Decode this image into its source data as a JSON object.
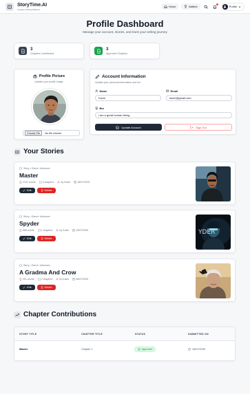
{
  "app": {
    "name": "StoryTime.AI",
    "tagline": "Creative Writing Platform"
  },
  "nav": {
    "home": "Home",
    "battles": "Battles",
    "profile": "Profile"
  },
  "page": {
    "title": "Profile Dashboard",
    "subtitle": "Manage your account, stories, and track your writing journey"
  },
  "stats": [
    {
      "value": "3",
      "label": "Chapters Contributed",
      "color": "#374151",
      "bg": "#374151"
    },
    {
      "value": "3",
      "label": "Approved Chapters",
      "color": "#16a34a",
      "bg": "#16a34a"
    }
  ],
  "profile_picture": {
    "title": "Profile Picture",
    "subtitle": "Update your profile image",
    "choose_file": "Choose File",
    "no_file": "No file chosen"
  },
  "account": {
    "title": "Account Information",
    "subtitle": "Update your personal information and bio",
    "name_label": "Name",
    "name_value": "Kavin",
    "email_label": "Email",
    "email_value": "kavin@gmail.com",
    "bio_label": "Bio",
    "bio_value": "i am a great human being",
    "update_btn": "Update Account",
    "signout_btn": "Sign Out"
  },
  "stories_section": {
    "heading": "Your Stories",
    "items": [
      {
        "meta": "Story • Genre: Unknown",
        "title": "Master",
        "words": "2131 words",
        "chapters": "3 chapters",
        "author": "by Kavin",
        "date": "18/07/2025",
        "edit": "Edit",
        "delete": "Delete"
      },
      {
        "meta": "Story • Genre: Unknown",
        "title": "Spyder",
        "words": "886 words",
        "chapters": "1 chapters",
        "author": "by Kavin",
        "date": "19/07/2025",
        "edit": "Edit",
        "delete": "Delete"
      },
      {
        "meta": "Story • Genre: Unknown",
        "title": "A Gradma And Crow",
        "words": "251 words",
        "chapters": "2 chapters",
        "author": "by Kavin",
        "date": "06/07/2025",
        "edit": "Edit",
        "delete": "Delete"
      }
    ]
  },
  "contributions": {
    "heading": "Chapter Contributions",
    "columns": [
      "STORY TITLE",
      "CHAPTER TITLE",
      "STATUS",
      "SUBMITTED ON"
    ],
    "rows": [
      {
        "story": "Master",
        "chapter": "Chapter 1",
        "status": "Approved",
        "date": "18/07/2025"
      }
    ]
  },
  "colors": {
    "accent": "#1f2937",
    "danger": "#dc2626",
    "success": "#16a34a"
  }
}
